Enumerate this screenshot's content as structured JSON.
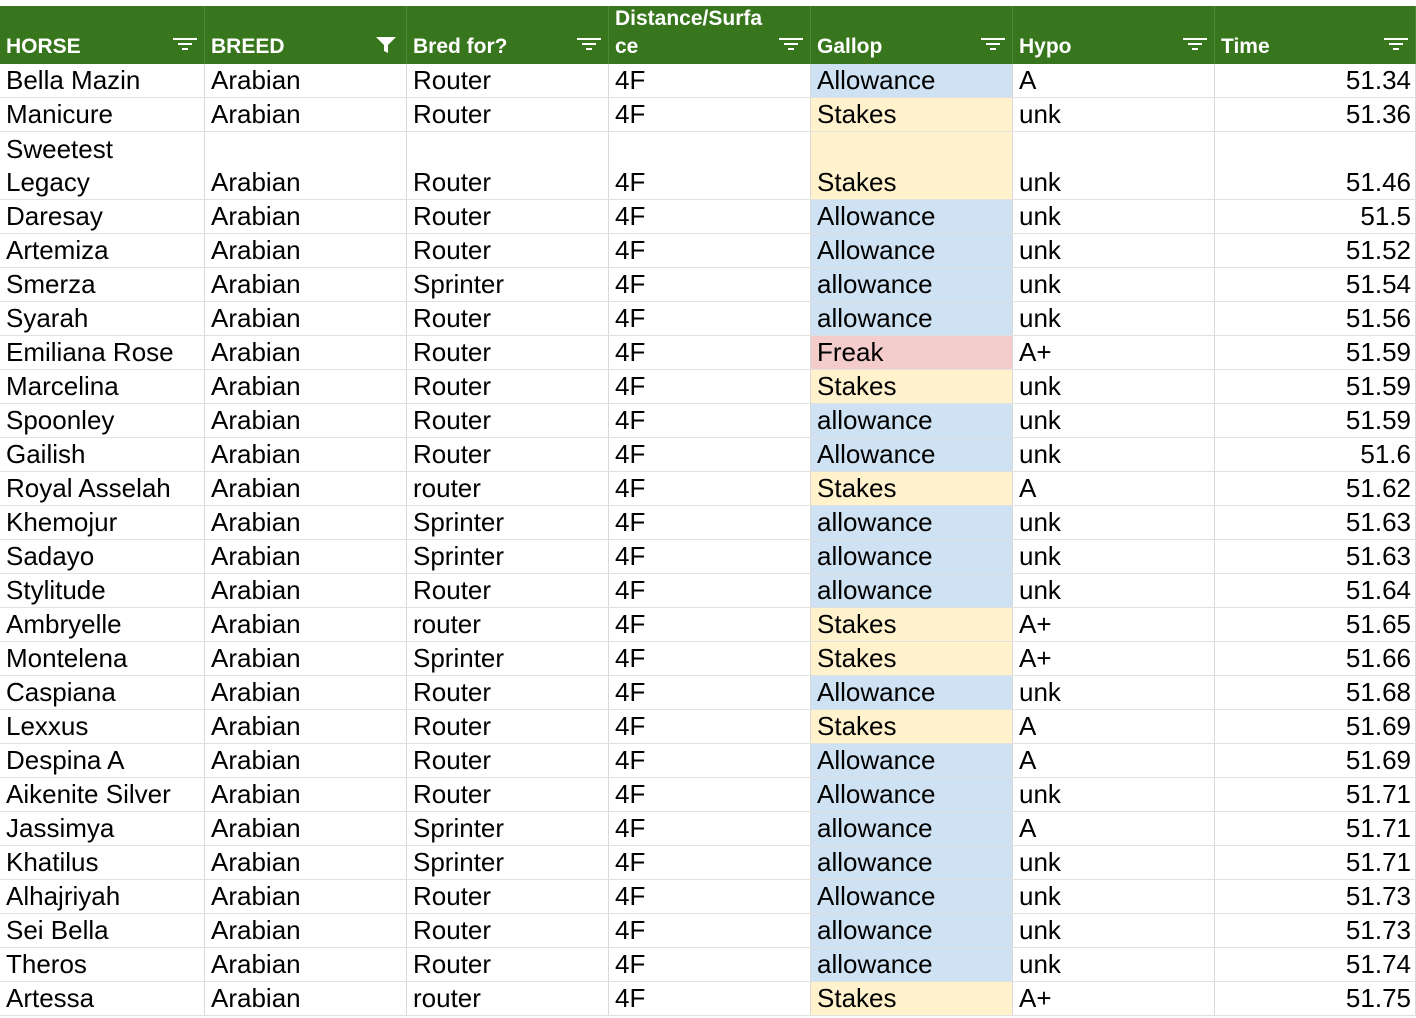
{
  "columns": [
    {
      "label": "HORSE"
    },
    {
      "label": "BREED"
    },
    {
      "label": "Bred for?"
    },
    {
      "label": "Distance/Surfa\nce"
    },
    {
      "label": "Gallop"
    },
    {
      "label": "Hypo"
    },
    {
      "label": "Time"
    }
  ],
  "filter_state": [
    "sort-filter",
    "filter-active",
    "sort-filter",
    "sort-filter",
    "sort-filter",
    "sort-filter",
    "sort-filter"
  ],
  "colors": {
    "header_bg": "#38761d",
    "header_text": "#ffffff",
    "allowance_fill": "#cfe2f3",
    "stakes_fill": "#fff2cc",
    "freak_fill": "#f4cccc"
  },
  "rows": [
    {
      "horse": "Bella Mazin",
      "breed": "Arabian",
      "bred_for": "Router",
      "distance": "4F",
      "gallop": "Allowance",
      "hypo": "A",
      "time": "51.34"
    },
    {
      "horse": "Manicure",
      "breed": "Arabian",
      "bred_for": "Router",
      "distance": "4F",
      "gallop": "Stakes",
      "hypo": "unk",
      "time": "51.36"
    },
    {
      "horse": "Sweetest\nLegacy",
      "breed": "Arabian",
      "bred_for": "Router",
      "distance": "4F",
      "gallop": "Stakes",
      "hypo": "unk",
      "time": "51.46"
    },
    {
      "horse": "Daresay",
      "breed": "Arabian",
      "bred_for": "Router",
      "distance": "4F",
      "gallop": "Allowance",
      "hypo": "unk",
      "time": "51.5"
    },
    {
      "horse": "Artemiza",
      "breed": "Arabian",
      "bred_for": "Router",
      "distance": "4F",
      "gallop": "Allowance",
      "hypo": "unk",
      "time": "51.52"
    },
    {
      "horse": "Smerza",
      "breed": "Arabian",
      "bred_for": "Sprinter",
      "distance": "4F",
      "gallop": "allowance",
      "hypo": "unk",
      "time": "51.54"
    },
    {
      "horse": "Syarah",
      "breed": "Arabian",
      "bred_for": "Router",
      "distance": "4F",
      "gallop": "allowance",
      "hypo": "unk",
      "time": "51.56"
    },
    {
      "horse": "Emiliana Rose",
      "breed": "Arabian",
      "bred_for": "Router",
      "distance": "4F",
      "gallop": "Freak",
      "hypo": "A+",
      "time": "51.59"
    },
    {
      "horse": "Marcelina",
      "breed": "Arabian",
      "bred_for": "Router",
      "distance": "4F",
      "gallop": "Stakes",
      "hypo": "unk",
      "time": "51.59"
    },
    {
      "horse": "Spoonley",
      "breed": "Arabian",
      "bred_for": "Router",
      "distance": "4F",
      "gallop": "allowance",
      "hypo": "unk",
      "time": "51.59"
    },
    {
      "horse": "Gailish",
      "breed": "Arabian",
      "bred_for": "Router",
      "distance": "4F",
      "gallop": "Allowance",
      "hypo": "unk",
      "time": "51.6"
    },
    {
      "horse": "Royal Asselah",
      "breed": "Arabian",
      "bred_for": "router",
      "distance": "4F",
      "gallop": "Stakes",
      "hypo": "A",
      "time": "51.62"
    },
    {
      "horse": "Khemojur",
      "breed": "Arabian",
      "bred_for": "Sprinter",
      "distance": "4F",
      "gallop": "allowance",
      "hypo": "unk",
      "time": "51.63"
    },
    {
      "horse": "Sadayo",
      "breed": "Arabian",
      "bred_for": "Sprinter",
      "distance": "4F",
      "gallop": "allowance",
      "hypo": "unk",
      "time": "51.63"
    },
    {
      "horse": "Stylitude",
      "breed": "Arabian",
      "bred_for": "Router",
      "distance": "4F",
      "gallop": "allowance",
      "hypo": "unk",
      "time": "51.64"
    },
    {
      "horse": "Ambryelle",
      "breed": "Arabian",
      "bred_for": "router",
      "distance": "4F",
      "gallop": "Stakes",
      "hypo": "A+",
      "time": "51.65"
    },
    {
      "horse": "Montelena",
      "breed": "Arabian",
      "bred_for": "Sprinter",
      "distance": "4F",
      "gallop": "Stakes",
      "hypo": "A+",
      "time": "51.66"
    },
    {
      "horse": "Caspiana",
      "breed": "Arabian",
      "bred_for": "Router",
      "distance": "4F",
      "gallop": "Allowance",
      "hypo": "unk",
      "time": "51.68"
    },
    {
      "horse": "Lexxus",
      "breed": "Arabian",
      "bred_for": "Router",
      "distance": "4F",
      "gallop": "Stakes",
      "hypo": "A",
      "time": "51.69"
    },
    {
      "horse": "Despina A",
      "breed": "Arabian",
      "bred_for": "Router",
      "distance": "4F",
      "gallop": "Allowance",
      "hypo": "A",
      "time": "51.69"
    },
    {
      "horse": "Aikenite Silver",
      "breed": "Arabian",
      "bred_for": "Router",
      "distance": "4F",
      "gallop": "Allowance",
      "hypo": "unk",
      "time": "51.71"
    },
    {
      "horse": "Jassimya",
      "breed": "Arabian",
      "bred_for": "Sprinter",
      "distance": "4F",
      "gallop": "allowance",
      "hypo": "A",
      "time": "51.71"
    },
    {
      "horse": "Khatilus",
      "breed": "Arabian",
      "bred_for": "Sprinter",
      "distance": "4F",
      "gallop": "allowance",
      "hypo": "unk",
      "time": "51.71"
    },
    {
      "horse": "Alhajriyah",
      "breed": "Arabian",
      "bred_for": "Router",
      "distance": "4F",
      "gallop": "Allowance",
      "hypo": "unk",
      "time": "51.73"
    },
    {
      "horse": "Sei Bella",
      "breed": "Arabian",
      "bred_for": "Router",
      "distance": "4F",
      "gallop": "allowance",
      "hypo": "unk",
      "time": "51.73"
    },
    {
      "horse": "Theros",
      "breed": "Arabian",
      "bred_for": "Router",
      "distance": "4F",
      "gallop": "allowance",
      "hypo": "unk",
      "time": "51.74"
    },
    {
      "horse": "Artessa",
      "breed": "Arabian",
      "bred_for": "router",
      "distance": "4F",
      "gallop": "Stakes",
      "hypo": "A+",
      "time": "51.75"
    }
  ]
}
